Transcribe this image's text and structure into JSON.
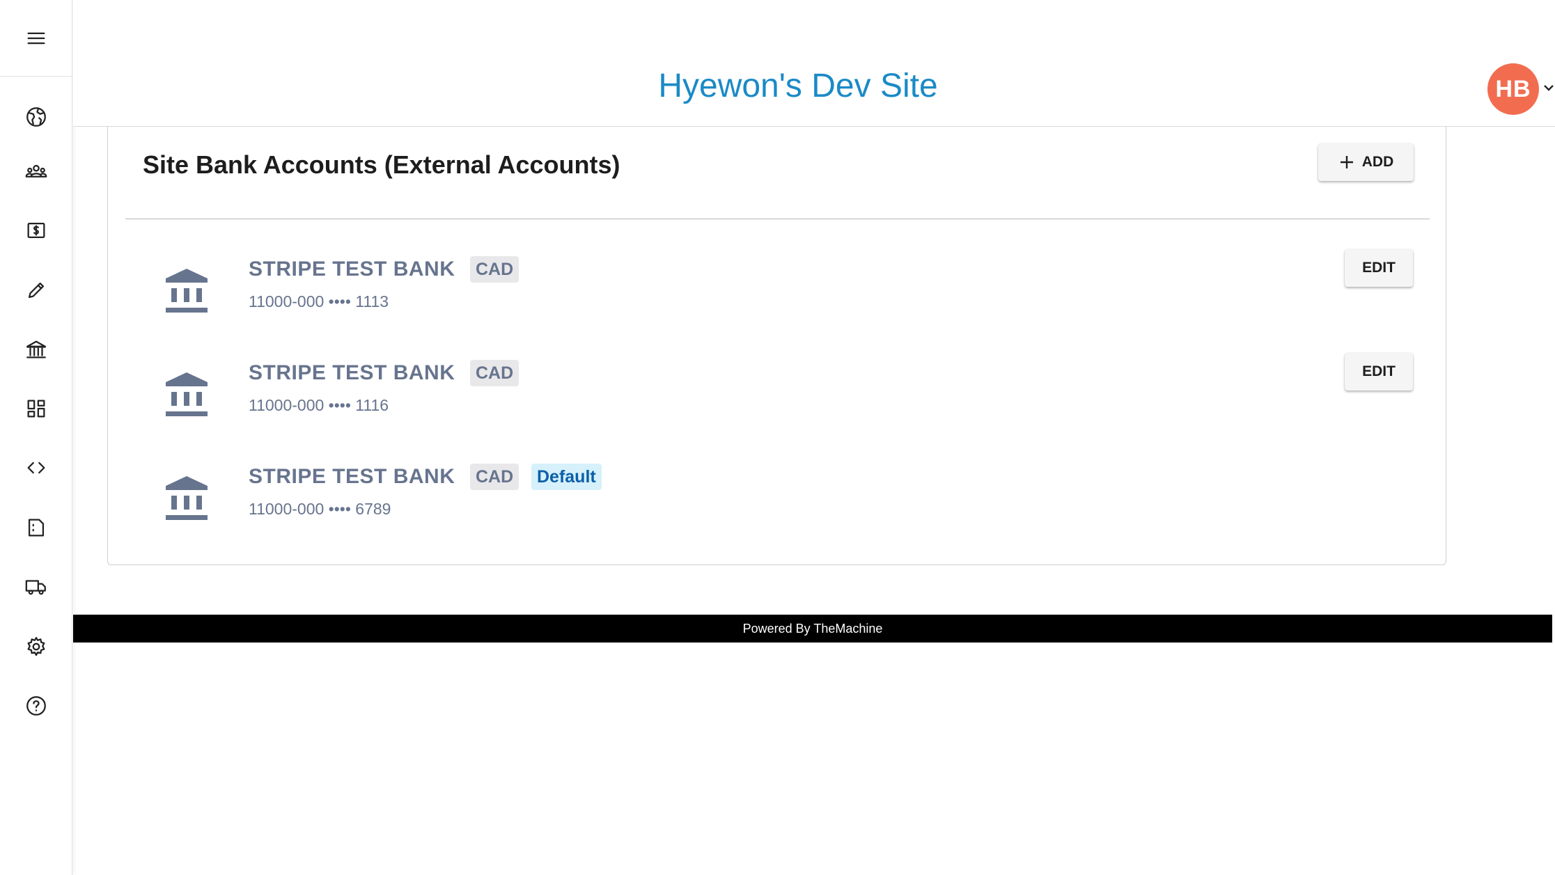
{
  "header": {
    "site_title": "Hyewon's Dev Site",
    "avatar_initials": "HB",
    "avatar_color": "#f26d50"
  },
  "sidebar": {
    "menu_icon": "hamburger-menu-icon",
    "items": [
      {
        "icon": "globe-icon"
      },
      {
        "icon": "users-group-icon"
      },
      {
        "icon": "dollar-bill-icon"
      },
      {
        "icon": "pencil-icon"
      },
      {
        "icon": "bank-icon"
      },
      {
        "icon": "dashboard-grid-icon"
      },
      {
        "icon": "code-icon"
      },
      {
        "icon": "document-icon"
      },
      {
        "icon": "truck-icon"
      },
      {
        "icon": "gear-icon"
      },
      {
        "icon": "help-icon"
      }
    ]
  },
  "main": {
    "card_title": "Site Bank Accounts (External Accounts)",
    "add_label": "ADD",
    "edit_label": "EDIT",
    "accounts": [
      {
        "name": "STRIPE TEST BANK",
        "currency": "CAD",
        "number": "11000-000 •••• 1113",
        "is_default": false
      },
      {
        "name": "STRIPE TEST BANK",
        "currency": "CAD",
        "number": "11000-000 •••• 1116",
        "is_default": false
      },
      {
        "name": "STRIPE TEST BANK",
        "currency": "CAD",
        "number": "11000-000 •••• 6789",
        "is_default": true,
        "default_label": "Default"
      }
    ]
  },
  "footer": {
    "text": "Powered By TheMachine"
  },
  "colors": {
    "title_blue": "#1a8ac7",
    "account_gray": "#67748e",
    "default_badge_bg": "#d6f1fb",
    "default_badge_text": "#0c5fa8"
  }
}
